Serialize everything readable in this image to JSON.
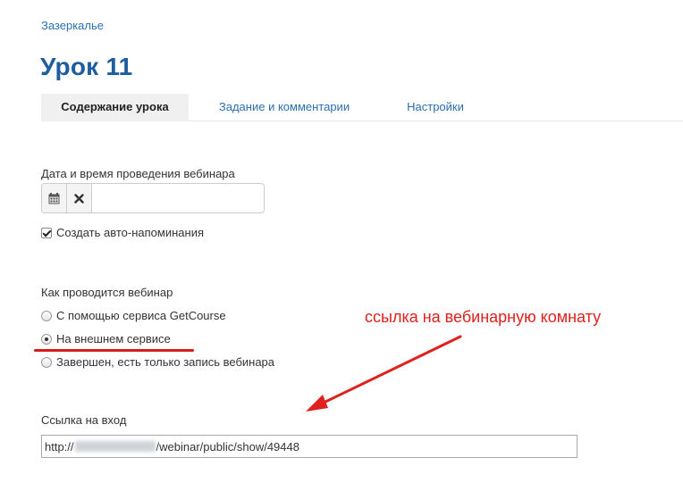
{
  "breadcrumb": {
    "label": "Зазеркалье"
  },
  "page": {
    "title": "Урок 11"
  },
  "tabs": [
    {
      "label": "Содержание урока",
      "active": true
    },
    {
      "label": "Задание и комментарии",
      "active": false
    },
    {
      "label": "Настройки",
      "active": false
    }
  ],
  "webinar_datetime": {
    "label": "Дата и время проведения вебинара",
    "value": "",
    "calendar_icon": "calendar-icon",
    "clear_icon": "close-icon"
  },
  "reminder": {
    "label": "Создать авто-напоминания",
    "checked": true
  },
  "mode": {
    "label": "Как проводится вебинар",
    "options": [
      {
        "label": "С помощью сервиса GetCourse",
        "checked": false
      },
      {
        "label": "На внешнем сервисе",
        "checked": true
      },
      {
        "label": "Завершен, есть только запись вебинара",
        "checked": false
      }
    ]
  },
  "annotation": {
    "text": "ссылка на вебинарную комнату",
    "color": "#e0201c"
  },
  "entry_link": {
    "label": "Ссылка на вход",
    "value_prefix": "http://",
    "value_suffix": "/webinar/public/show/49448"
  },
  "colors": {
    "link": "#2a6fb0",
    "title": "#1e5d9e",
    "annotation": "#e0201c"
  }
}
